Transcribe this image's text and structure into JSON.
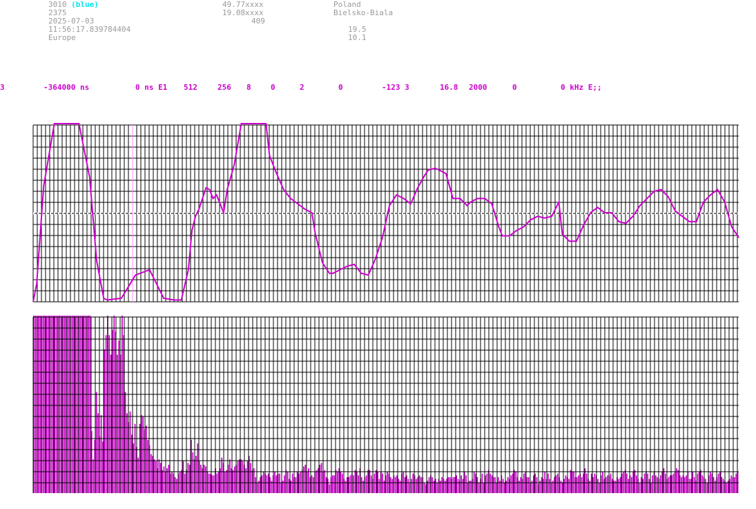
{
  "header": {
    "station_id": "3010",
    "station_color": "(blue)",
    "number": "2375",
    "date": "2025-07-03",
    "time": "11:56:17.839784404",
    "region": "Europe",
    "lat": "49.77xxxx",
    "lon": "19.08xxxx",
    "alt": "409",
    "country": "Poland",
    "city": "Bielsko-Biala",
    "value_a": "19.5",
    "value_b": "10.1"
  },
  "params": [
    "3",
    "-364000 ns",
    "0 ns E1",
    "512",
    "256",
    "8",
    "0",
    "2",
    "0",
    "-123 3",
    "16.8",
    "2000",
    "0",
    "0 kHz E;;"
  ],
  "colors": {
    "grid": "#000000",
    "trace": "#cc00cc",
    "bars": "#cc00cc",
    "label_grey": "#9a9a9a",
    "label_cyan": "#00e5ee",
    "params": "#cc00cc"
  },
  "chart_data": [
    {
      "type": "line",
      "x": [
        0,
        1,
        3,
        6,
        7,
        9,
        11,
        13,
        16,
        18,
        20,
        21,
        25,
        29,
        33,
        37,
        40,
        42,
        44,
        45,
        46,
        47,
        49,
        50,
        51,
        52,
        54,
        55,
        57,
        59,
        62,
        62.5,
        63,
        64,
        65,
        66,
        67,
        69,
        71,
        73,
        75,
        77,
        79,
        80,
        82,
        84,
        85,
        86,
        88,
        89,
        91,
        93,
        95,
        97,
        99,
        101,
        103,
        105,
        107,
        109,
        111,
        112,
        114,
        115,
        117,
        119,
        121,
        123,
        124,
        126,
        128,
        130,
        132,
        133,
        135,
        137,
        139,
        141,
        143,
        145,
        147,
        149,
        150,
        152,
        154,
        156,
        158,
        160,
        162,
        164,
        166,
        168,
        170,
        172,
        174,
        176,
        178,
        180,
        182,
        184,
        186,
        188,
        190,
        192,
        194,
        196,
        198,
        200
      ],
      "y": [
        0,
        10,
        65,
        100,
        100,
        100,
        100,
        100,
        70,
        23,
        2,
        1,
        2,
        15,
        18,
        2,
        1,
        1,
        18,
        40,
        48,
        52,
        64,
        63,
        58,
        60,
        50,
        63,
        77,
        100,
        100,
        100,
        100,
        100,
        100,
        100,
        82,
        72,
        63,
        58,
        55,
        52,
        50,
        38,
        22,
        16,
        16,
        17,
        19,
        20,
        21,
        16,
        15,
        24,
        36,
        54,
        60,
        58,
        55,
        64,
        71,
        74,
        75,
        74,
        72,
        58,
        58,
        54,
        56,
        58,
        58,
        55,
        42,
        37,
        37,
        40,
        42,
        46,
        48,
        47,
        48,
        56,
        38,
        34,
        34,
        43,
        50,
        53,
        50,
        50,
        45,
        44,
        48,
        54,
        58,
        62,
        63,
        59,
        51,
        48,
        45,
        45,
        56,
        60,
        63,
        56,
        42,
        36
      ]
    },
    {
      "type": "bar",
      "values": [
        100,
        100,
        100,
        100,
        100,
        100,
        100,
        100,
        100,
        100,
        100,
        100,
        100,
        100,
        100,
        100,
        100,
        100,
        100,
        100,
        100,
        100,
        100,
        100,
        100,
        100,
        100,
        100,
        100,
        100,
        100,
        100,
        100,
        100,
        100,
        100,
        35,
        19,
        30,
        57,
        45,
        32,
        44,
        29,
        81,
        89,
        100,
        89,
        78,
        92,
        100,
        91,
        78,
        86,
        78,
        100,
        89,
        57,
        45,
        40,
        46,
        33,
        28,
        39,
        26,
        20,
        39,
        44,
        43,
        36,
        38,
        30,
        27,
        22,
        21,
        19,
        18,
        14,
        19,
        17,
        13,
        15,
        12,
        14,
        16,
        11,
        12,
        11,
        9,
        8,
        11,
        12,
        13,
        18,
        11,
        13,
        17,
        16,
        30,
        23,
        19,
        21,
        28,
        18,
        16,
        14,
        16,
        15,
        12,
        11,
        11,
        10,
        10,
        14,
        11,
        12,
        14,
        20,
        17,
        12,
        13,
        16,
        19,
        14,
        13,
        15,
        16,
        18,
        19,
        19,
        18,
        16,
        14,
        18,
        21,
        17,
        13,
        14,
        9,
        6,
        7,
        9,
        10,
        12,
        11,
        10,
        11,
        9,
        7,
        10,
        12,
        10,
        11,
        11,
        6,
        7,
        10,
        13,
        12,
        8,
        7,
        11,
        9,
        9,
        12,
        11,
        12,
        13,
        15,
        16,
        12,
        14,
        9,
        10,
        9,
        12,
        13,
        14,
        16,
        17,
        12,
        13,
        9,
        8,
        5,
        9,
        10,
        10,
        13,
        12,
        14,
        12,
        11,
        8,
        7,
        9,
        9,
        10,
        11,
        10,
        13,
        12,
        10,
        14,
        9,
        7,
        9,
        10,
        13,
        13,
        10,
        8,
        11,
        13,
        12,
        8,
        12,
        11,
        7,
        10,
        12,
        11,
        9,
        8,
        10,
        9,
        10,
        8,
        7,
        11,
        12,
        9,
        10,
        8,
        6,
        8,
        11,
        10,
        8,
        9,
        10,
        9,
        9,
        6,
        5,
        7,
        9,
        10,
        9,
        7,
        8,
        6,
        8,
        7,
        9,
        8,
        7,
        8,
        9,
        9,
        8,
        9,
        9,
        10,
        8,
        7,
        10,
        8,
        12,
        10,
        6,
        7,
        7,
        8,
        12,
        11,
        9,
        6,
        8,
        11,
        6,
        10,
        11,
        13,
        11,
        10,
        9,
        9,
        6,
        9,
        7,
        10,
        8,
        6,
        7,
        9,
        8,
        10,
        11,
        13,
        12,
        9,
        7,
        9,
        8,
        11,
        12,
        9,
        9,
        6,
        7,
        10,
        11,
        9,
        5,
        7,
        9,
        8,
        12,
        8,
        11,
        8,
        6,
        7,
        9,
        10,
        11,
        9,
        7,
        6,
        8,
        10,
        9,
        8,
        13,
        12,
        12,
        9,
        9,
        10,
        11,
        9,
        11,
        14,
        11,
        8,
        7,
        11,
        9,
        11,
        10,
        8,
        6,
        10,
        12,
        8,
        9,
        10,
        10,
        11,
        8,
        7,
        7,
        9,
        8,
        9,
        11,
        12,
        13,
        11,
        8,
        10,
        9,
        12,
        13,
        10,
        8,
        6,
        9,
        8,
        11,
        12,
        11,
        8,
        6,
        10,
        12,
        10,
        9,
        8,
        10,
        12,
        14,
        11,
        8,
        9,
        10,
        10,
        11,
        12,
        14,
        13,
        10,
        9,
        10,
        9,
        10,
        12,
        8,
        8,
        12,
        9,
        7,
        11,
        12,
        13,
        10,
        9,
        8,
        6,
        10,
        12,
        11,
        9,
        7,
        9,
        11,
        12,
        9,
        8,
        7,
        6,
        7,
        8,
        10,
        9,
        9,
        11,
        12
      ]
    }
  ]
}
